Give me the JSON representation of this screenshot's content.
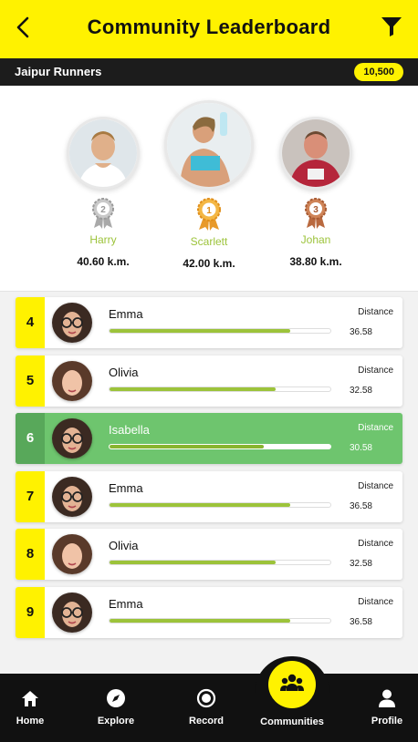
{
  "header": {
    "title": "Community Leaderboard",
    "back_icon": "back-arrow-icon",
    "filter_icon": "filter-icon"
  },
  "community": {
    "name": "Jaipur Runners",
    "points": "10,500"
  },
  "podium": [
    {
      "position": "2",
      "name": "Harry",
      "distance": "40.60 k.m.",
      "medal": "silver"
    },
    {
      "position": "1",
      "name": "Scarlett",
      "distance": "42.00 k.m.",
      "medal": "gold"
    },
    {
      "position": "3",
      "name": "Johan",
      "distance": "38.80 k.m.",
      "medal": "bronze"
    }
  ],
  "leaderboard": [
    {
      "rank": "4",
      "name": "Emma",
      "distance_label": "Distance",
      "distance": "36.58",
      "progress": 0.82
    },
    {
      "rank": "5",
      "name": "Olivia",
      "distance_label": "Distance",
      "distance": "32.58",
      "progress": 0.75
    },
    {
      "rank": "6",
      "name": "Isabella",
      "distance_label": "Distance",
      "distance": "30.58",
      "progress": 0.7,
      "highlighted": true
    },
    {
      "rank": "7",
      "name": "Emma",
      "distance_label": "Distance",
      "distance": "36.58",
      "progress": 0.82
    },
    {
      "rank": "8",
      "name": "Olivia",
      "distance_label": "Distance",
      "distance": "32.58",
      "progress": 0.75
    },
    {
      "rank": "9",
      "name": "Emma",
      "distance_label": "Distance",
      "distance": "36.58",
      "progress": 0.82
    }
  ],
  "nav": {
    "items": [
      {
        "label": "Home",
        "icon": "home-icon"
      },
      {
        "label": "Explore",
        "icon": "compass-icon"
      },
      {
        "label": "Record",
        "icon": "record-icon"
      },
      {
        "label": "Communities",
        "icon": "people-icon"
      },
      {
        "label": "Profile",
        "icon": "user-icon"
      }
    ]
  },
  "colors": {
    "accent": "#fff200",
    "green": "#9cc33a",
    "highlight": "#6ec56e",
    "dark": "#111111"
  }
}
